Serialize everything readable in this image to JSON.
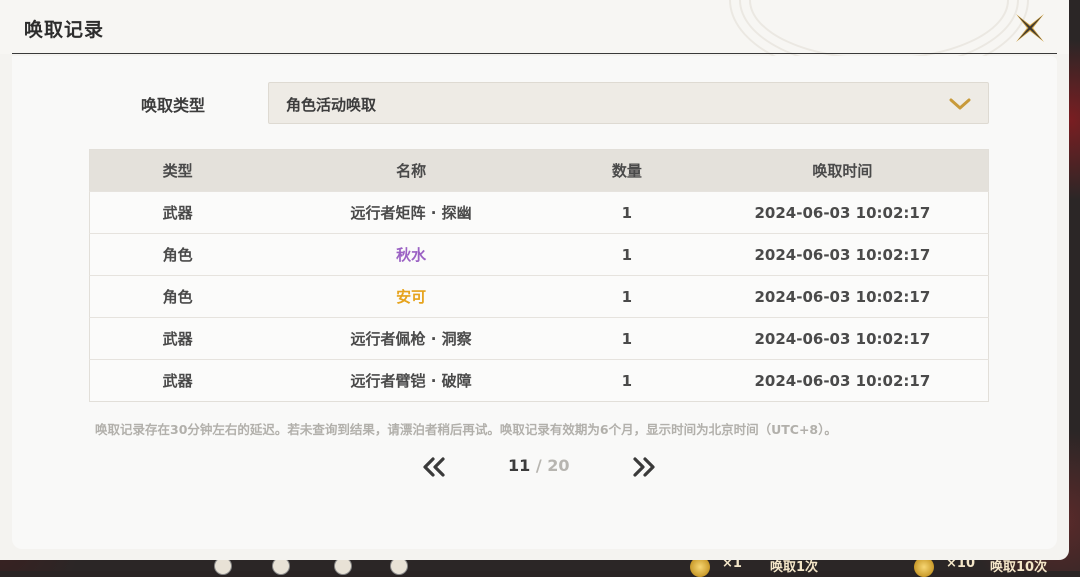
{
  "dialog": {
    "title": "唤取记录"
  },
  "filter": {
    "label": "唤取类型",
    "selected": "角色活动唤取"
  },
  "table": {
    "headers": [
      "类型",
      "名称",
      "数量",
      "唤取时间"
    ],
    "rows": [
      {
        "type": "武器",
        "name": "远行者矩阵 · 探幽",
        "qty": "1",
        "time": "2024-06-03 10:02:17",
        "name_color": "#4a4a4a"
      },
      {
        "type": "角色",
        "name": "秋水",
        "qty": "1",
        "time": "2024-06-03 10:02:17",
        "name_color": "#9b62c4"
      },
      {
        "type": "角色",
        "name": "安可",
        "qty": "1",
        "time": "2024-06-03 10:02:17",
        "name_color": "#e6a31c"
      },
      {
        "type": "武器",
        "name": "远行者佩枪 · 洞察",
        "qty": "1",
        "time": "2024-06-03 10:02:17",
        "name_color": "#4a4a4a"
      },
      {
        "type": "武器",
        "name": "远行者臂铠 · 破障",
        "qty": "1",
        "time": "2024-06-03 10:02:17",
        "name_color": "#4a4a4a"
      }
    ]
  },
  "notice": "唤取记录存在30分钟左右的延迟。若未查询到结果，请漂泊者稍后再试。唤取记录有效期为6个月，显示时间为北京时间（UTC+8）。",
  "pagination": {
    "current": "11",
    "separator": " / ",
    "total": "20"
  },
  "bottom_bar": {
    "single_count": "×1",
    "single_label": "唤取1次",
    "ten_count": "×10",
    "ten_label": "唤取10次"
  },
  "colors": {
    "accent": "#c89a3a",
    "panel": "#f9f9f8",
    "header_row": "#e4e1db"
  },
  "icons": {
    "close": "close-x-icon",
    "dropdown": "chevron-down-icon",
    "prev": "double-chevron-left-icon",
    "next": "double-chevron-right-icon"
  }
}
